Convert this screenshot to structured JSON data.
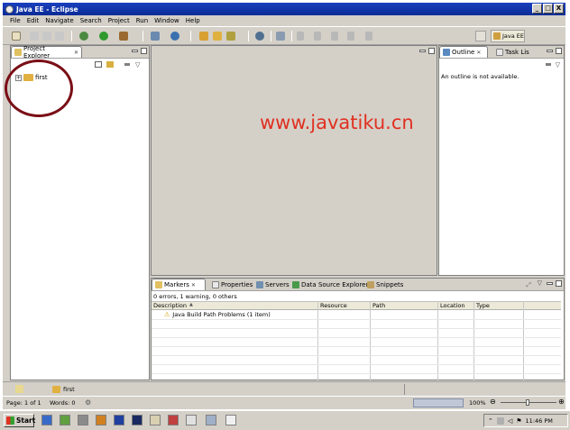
{
  "window": {
    "title": "Java EE - Eclipse",
    "buttons": [
      "_",
      "□",
      "X"
    ]
  },
  "menu": {
    "items": [
      "File",
      "Edit",
      "Navigate",
      "Search",
      "Project",
      "Run",
      "Window",
      "Help"
    ]
  },
  "toolbar": {
    "perspective_label": "Java EE"
  },
  "project_explorer": {
    "tab_label": "Project Explorer",
    "tree": [
      {
        "label": "first",
        "expander": "+"
      }
    ]
  },
  "outline": {
    "tabs": [
      "Outline",
      "Task Lis"
    ],
    "message": "An outline is not available."
  },
  "markers": {
    "tabs": [
      "Markers",
      "Properties",
      "Servers",
      "Data Source Explorer",
      "Snippets"
    ],
    "summary": "0 errors, 1 warning, 0 others",
    "columns": [
      "Description",
      "Resource",
      "Path",
      "Location",
      "Type"
    ],
    "rows": [
      {
        "description": "Java Build Path Problems (1 item)",
        "resource": "",
        "path": "",
        "location": "",
        "type": ""
      }
    ]
  },
  "status": {
    "selected": "first",
    "page": "Page: 1 of 1",
    "words": "Words: 0",
    "zoom": "100%"
  },
  "taskbar": {
    "start_label": "Start",
    "clock": "11:46 PM"
  },
  "watermark": "www.javatiku.cn",
  "colors": {
    "title_bar": "#0a2c96",
    "chrome": "#d4d0c8",
    "watermark": "#e03020",
    "annotation_circle": "#7a0e16"
  }
}
